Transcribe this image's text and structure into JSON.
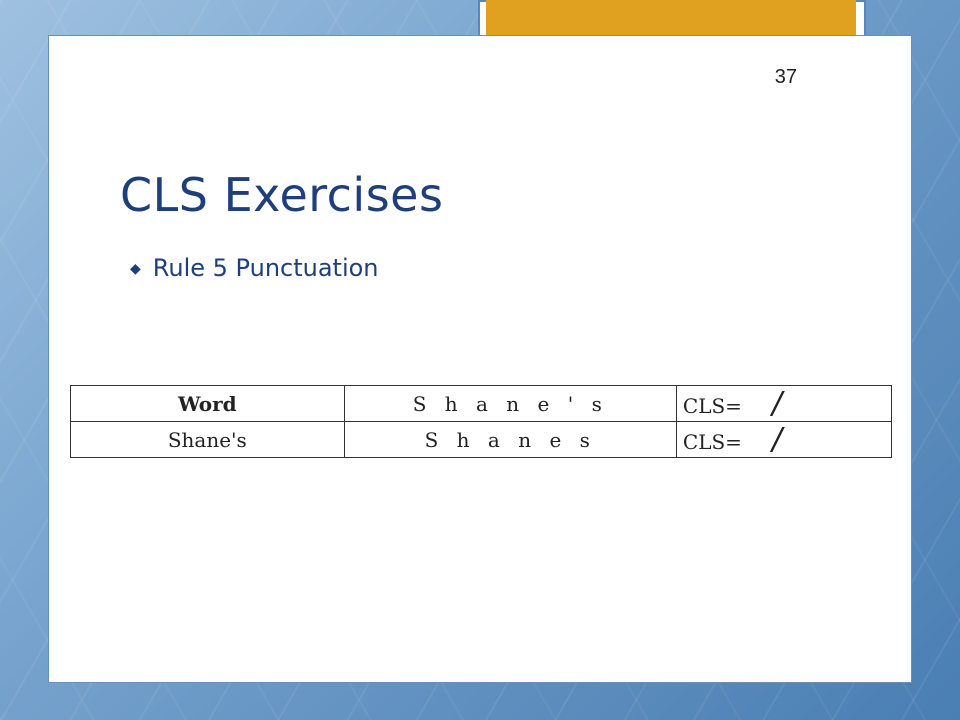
{
  "slide": {
    "page_number": "37",
    "title": "CLS Exercises",
    "bullet": "Rule 5 Punctuation"
  },
  "table": {
    "rows": [
      {
        "word": "Word",
        "spelling": "S h a n e ' s",
        "cls": "CLS=",
        "mark": "/"
      },
      {
        "word": "Shane's",
        "spelling": "S h a n e s",
        "cls": "CLS=",
        "mark": "/"
      }
    ]
  },
  "colors": {
    "accent_gold": "#e0a020",
    "title_blue": "#1f3f7a"
  }
}
